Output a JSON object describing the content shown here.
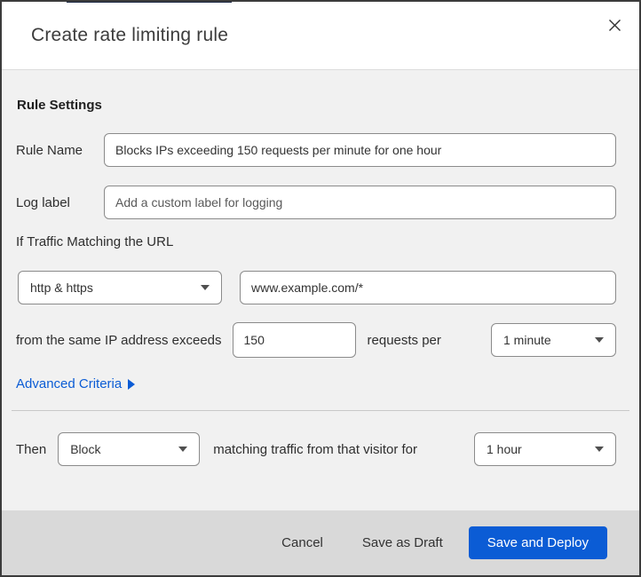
{
  "dialog": {
    "title": "Create rate limiting rule"
  },
  "icons": {
    "close": "close-icon",
    "chevron_right": "chevron-right-icon",
    "caret_down": "caret-down-icon"
  },
  "colors": {
    "accent_blue": "#0b5cd5",
    "link_blue": "#0b5cd5",
    "content_bg": "#f1f1f1",
    "footer_bg": "#d9d9d9",
    "top_edge_accent_navy": "#1a2744"
  },
  "form": {
    "section_heading": "Rule Settings",
    "rule_name": {
      "label": "Rule Name",
      "value": "Blocks IPs exceeding 150 requests per minute for one hour"
    },
    "log_label": {
      "label": "Log label",
      "placeholder": "Add a custom label for logging"
    },
    "traffic_match_heading": "If Traffic Matching the URL",
    "scheme_select": {
      "value": "http & https"
    },
    "url_input": {
      "value": "www.example.com/*"
    },
    "threshold": {
      "prefix": "from the same IP address exceeds",
      "requests_value": "150",
      "middle": "requests per",
      "period_select": {
        "value": "1 minute"
      }
    },
    "advanced_criteria": {
      "label": "Advanced Criteria"
    },
    "action": {
      "prefix": "Then",
      "action_select": {
        "value": "Block"
      },
      "middle": "matching traffic from that visitor for",
      "duration_select": {
        "value": "1 hour"
      }
    }
  },
  "footer": {
    "cancel_label": "Cancel",
    "save_draft_label": "Save as Draft",
    "save_deploy_label": "Save and Deploy"
  }
}
